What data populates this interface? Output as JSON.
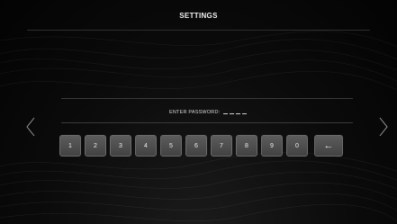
{
  "header": {
    "title": "SETTINGS"
  },
  "password": {
    "label": "ENTER PASSWORD:",
    "slots": 4
  },
  "keypad": {
    "keys": [
      "1",
      "2",
      "3",
      "4",
      "5",
      "6",
      "7",
      "8",
      "9",
      "0"
    ],
    "backspace_icon": "←"
  },
  "nav": {
    "prev_icon": "chevron-left-icon",
    "next_icon": "chevron-right-icon"
  },
  "colors": {
    "background": "#0b0b0b",
    "key_fill": "#4e4e4e",
    "text": "#f2f2f2"
  }
}
